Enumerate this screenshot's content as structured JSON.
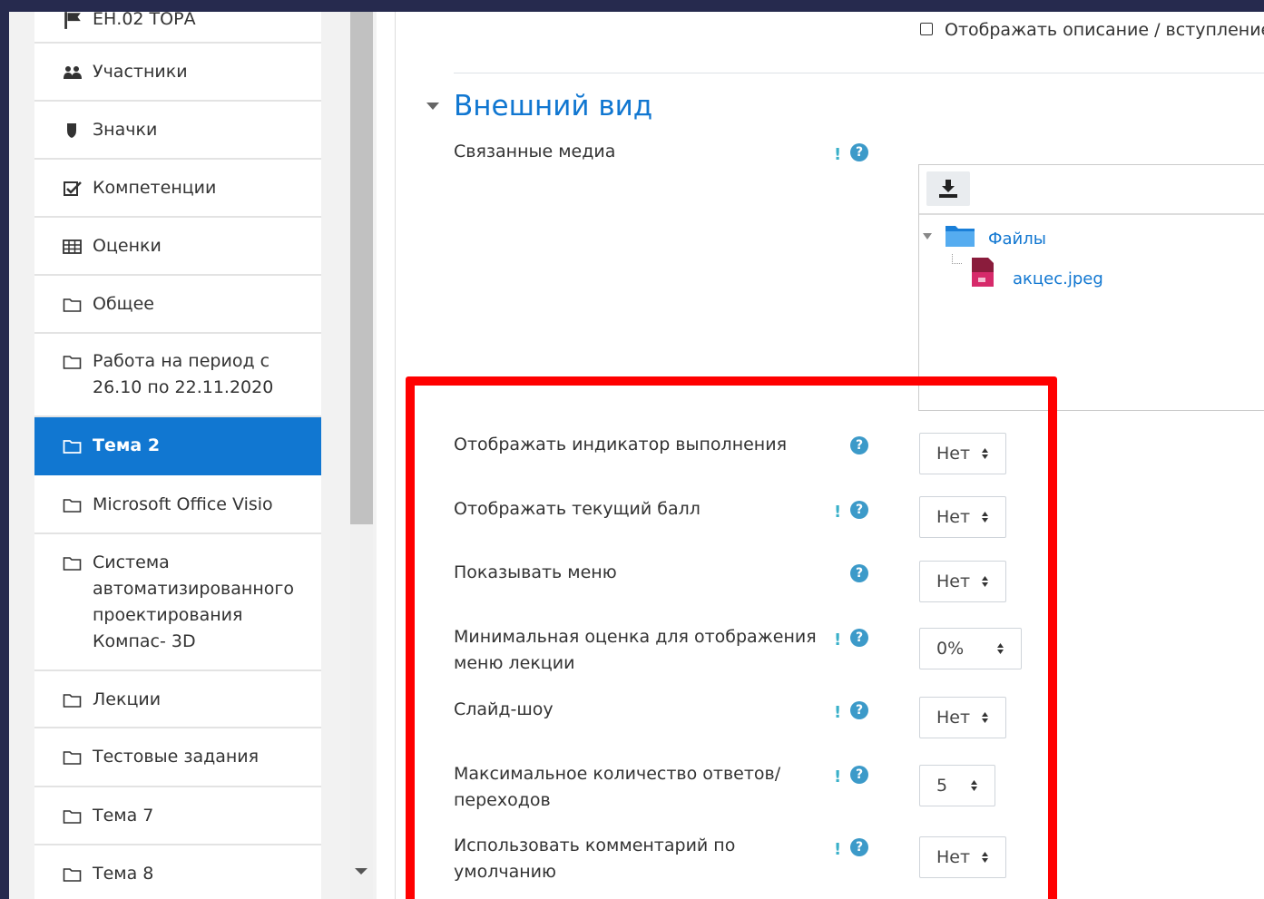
{
  "sidebar": {
    "items": [
      {
        "label": "ЕН.02 ТОРА",
        "icon": "flag-icon",
        "active": false
      },
      {
        "label": "Участники",
        "icon": "users-icon",
        "active": false
      },
      {
        "label": "Значки",
        "icon": "shield-icon",
        "active": false
      },
      {
        "label": "Компетенции",
        "icon": "checkbox-icon",
        "active": false
      },
      {
        "label": "Оценки",
        "icon": "table-icon",
        "active": false
      },
      {
        "label": "Общее",
        "icon": "folder-icon",
        "active": false
      },
      {
        "label": "Работа на период с 26.10 по 22.11.2020",
        "icon": "folder-icon",
        "active": false
      },
      {
        "label": "Тема 2",
        "icon": "folder-icon",
        "active": true
      },
      {
        "label": "Microsoft Office Visio",
        "icon": "folder-icon",
        "active": false
      },
      {
        "label": "Система автоматизированного проектирования Компас- 3D",
        "icon": "folder-icon",
        "active": false
      },
      {
        "label": "Лекции",
        "icon": "folder-icon",
        "active": false
      },
      {
        "label": "Тестовые задания",
        "icon": "folder-icon",
        "active": false
      },
      {
        "label": "Тема 7",
        "icon": "folder-icon",
        "active": false
      },
      {
        "label": "Тема 8",
        "icon": "folder-icon",
        "active": false
      }
    ]
  },
  "top_checkbox": {
    "label": "Отображать описание / вступление",
    "checked": false
  },
  "section": {
    "title": "Внешний вид"
  },
  "media": {
    "label": "Связанные медиа",
    "folder": "Файлы",
    "file": "акцес.jpeg"
  },
  "settings": [
    {
      "label": "Отображать индикатор выполнения",
      "value": "Нет",
      "advanced": false
    },
    {
      "label": "Отображать текущий балл",
      "value": "Нет",
      "advanced": true
    },
    {
      "label": "Показывать меню",
      "value": "Нет",
      "advanced": false
    },
    {
      "label": "Минимальная оценка для отображения меню лекции",
      "value": "0%",
      "advanced": true
    },
    {
      "label": "Слайд-шоу",
      "value": "Нет",
      "advanced": true
    },
    {
      "label": "Максимальное количество ответов/ переходов",
      "value": "5",
      "advanced": true
    },
    {
      "label": "Использовать комментарий по умолчанию",
      "value": "Нет",
      "advanced": true
    }
  ],
  "symbols": {
    "advanced_marker": "!",
    "help_marker": "?"
  },
  "colors": {
    "accent": "#1177d1",
    "highlight_box": "#ff0000",
    "help": "#3c9ac9",
    "background": "#262a4e"
  }
}
